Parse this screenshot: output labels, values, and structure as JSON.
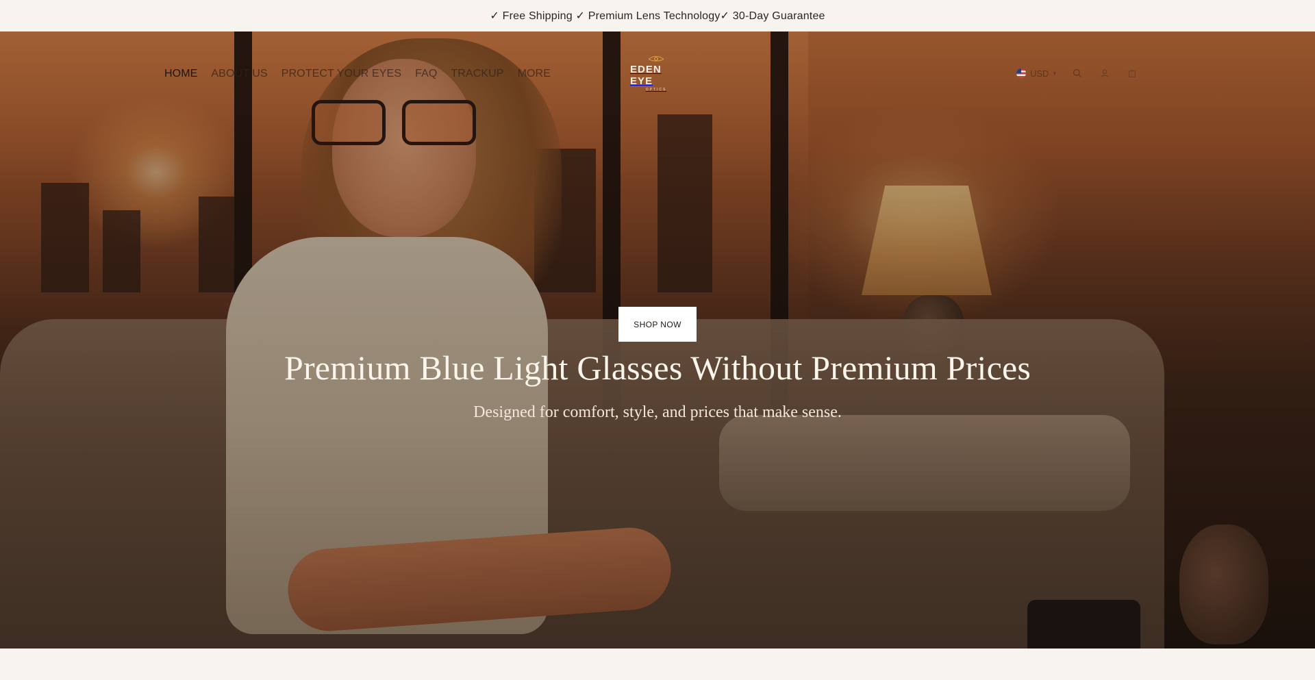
{
  "announcement": {
    "text": "✓ Free Shipping ✓ Premium Lens Technology✓ 30-Day Guarantee"
  },
  "header": {
    "nav": [
      {
        "label": "HOME"
      },
      {
        "label": "ABOUT US"
      },
      {
        "label": "PROTECT YOUR EYES"
      },
      {
        "label": "FAQ"
      },
      {
        "label": "TRACKUP"
      },
      {
        "label": "MORE"
      }
    ],
    "logo": {
      "word": "EDEN EYE",
      "sub": "OPTICS"
    },
    "currency": {
      "label": "USD"
    },
    "icons": [
      "search-icon",
      "account-icon",
      "cart-icon"
    ]
  },
  "hero": {
    "cta_label": "SHOP NOW",
    "headline": "Premium Blue Light Glasses Without Premium Prices",
    "subheadline": "Designed for comfort, style, and prices that make sense."
  },
  "colors": {
    "background": "#f7f3ee",
    "cta_background": "#ffffff",
    "headline": "#fbf5ec"
  }
}
